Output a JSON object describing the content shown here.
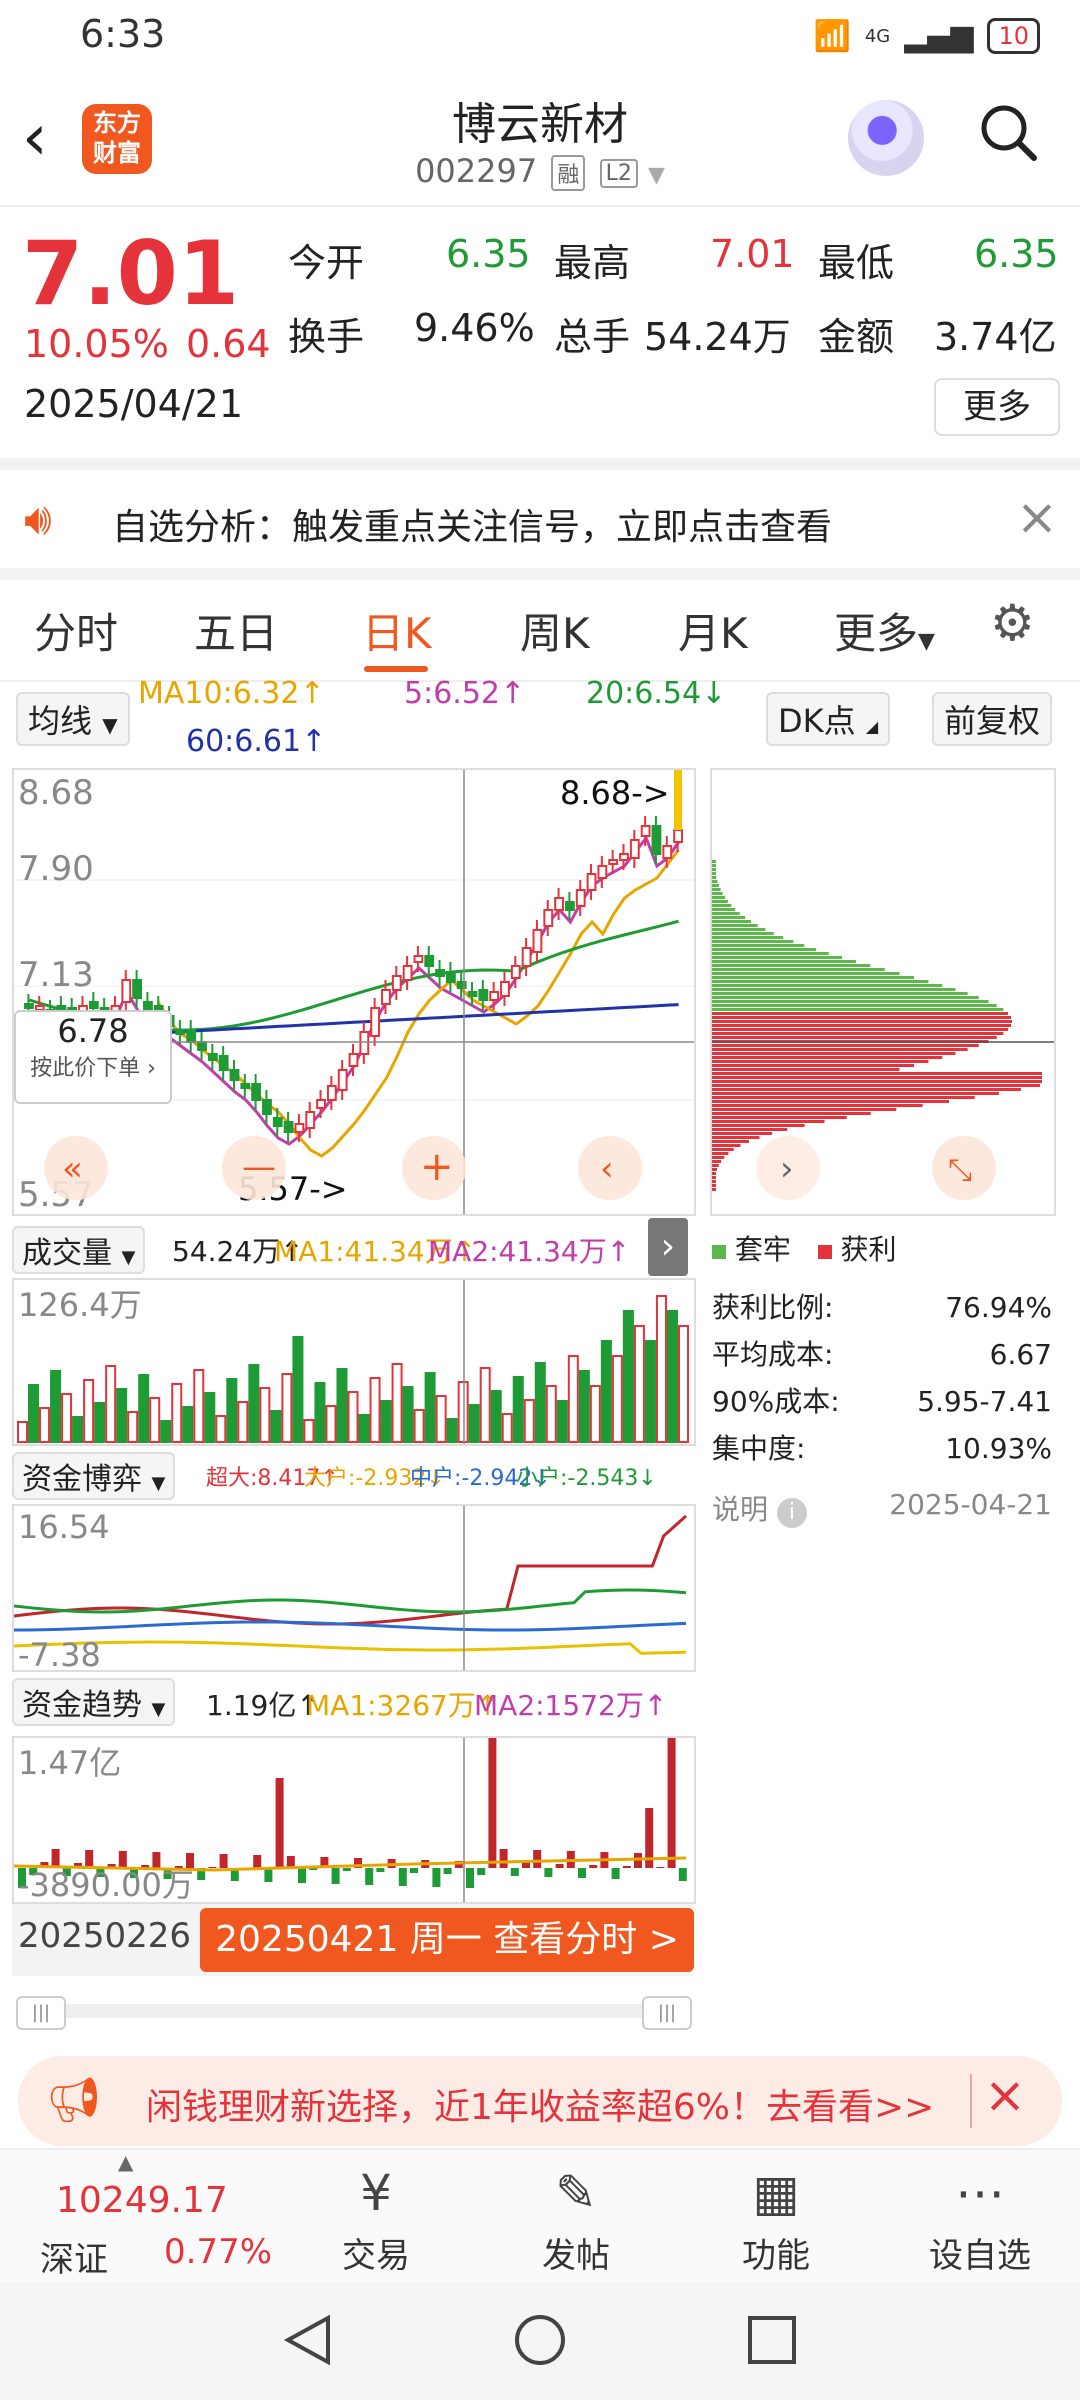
{
  "status": {
    "time": "6:33",
    "signal": "4G",
    "battery": "10"
  },
  "header": {
    "logo_line1": "东方",
    "logo_line2": "财富",
    "title": "博云新材",
    "code": "002297",
    "tag1": "融",
    "tag2": "L2"
  },
  "quote": {
    "price": "7.01",
    "change_pct": "10.05%",
    "change": "0.64",
    "date": "2025/04/21",
    "open_label": "今开",
    "open": "6.35",
    "high_label": "最高",
    "high": "7.01",
    "low_label": "最低",
    "low": "6.35",
    "turnover_label": "换手",
    "turnover": "9.46%",
    "volume_label": "总手",
    "volume": "54.24万",
    "amount_label": "金额",
    "amount": "3.74亿",
    "more": "更多"
  },
  "notice": {
    "text": "自选分析：触发重点关注信号，立即点击查看"
  },
  "tabs": [
    "分时",
    "五日",
    "日K",
    "周K",
    "月K",
    "更多",
    "⚙"
  ],
  "ma": {
    "selector": "均线",
    "ma10": "MA10:6.32↑",
    "ma5": "5:6.52↑",
    "ma20": "20:6.54↓",
    "ma60": "60:6.61↑",
    "dk": "DK点",
    "fq": "前复权"
  },
  "kline": {
    "y_top": "8.68",
    "y_mid1": "7.90",
    "y_mid2": "7.13",
    "y_bottom": "5.57",
    "high_marker": "8.68->",
    "low_marker": "5.57->",
    "cursor_price": "6.78",
    "cursor_hint": "按此价下单"
  },
  "chips": {
    "legend_loss": "套牢",
    "legend_profit": "获利",
    "rows": [
      {
        "label": "获利比例:",
        "value": "76.94%"
      },
      {
        "label": "平均成本:",
        "value": "6.67"
      },
      {
        "label": "90%成本:",
        "value": "5.95-7.41"
      },
      {
        "label": "集中度:",
        "value": "10.93%"
      }
    ],
    "note_label": "说明",
    "note_date": "2025-04-21"
  },
  "volume": {
    "selector": "成交量",
    "cur": "54.24万↑",
    "ma1": "MA1:41.34万↑",
    "ma2": "MA2:41.34万↑",
    "y_top": "126.4万"
  },
  "fund": {
    "selector": "资金博弈",
    "super": "超大:8.417↑",
    "big": "大户:-2.932↓",
    "mid": "中户:-2.942↓",
    "small": "小户:-2.543↓",
    "y_top": "16.54",
    "y_bottom": "-7.38"
  },
  "trend": {
    "selector": "资金趋势",
    "cur": "1.19亿↑",
    "ma1": "MA1:3267万↑",
    "ma2": "MA2:1572万↑",
    "y_top": "1.47亿",
    "y_bottom": "-3890.00万"
  },
  "range": {
    "start_date": "20250226",
    "cursor_label": "20250421 周一 查看分时 >"
  },
  "ad": {
    "text": "闲钱理财新选择，近1年收益率超6%！去看看>>"
  },
  "bottom": {
    "index_value": "10249.17",
    "index_name": "深证",
    "index_pct": "0.77%",
    "trade": "交易",
    "post": "发帖",
    "func": "功能",
    "watch": "设自选"
  },
  "colors": {
    "accent": "#f0581f",
    "up": "#e5333b",
    "down": "#1f9b35"
  }
}
